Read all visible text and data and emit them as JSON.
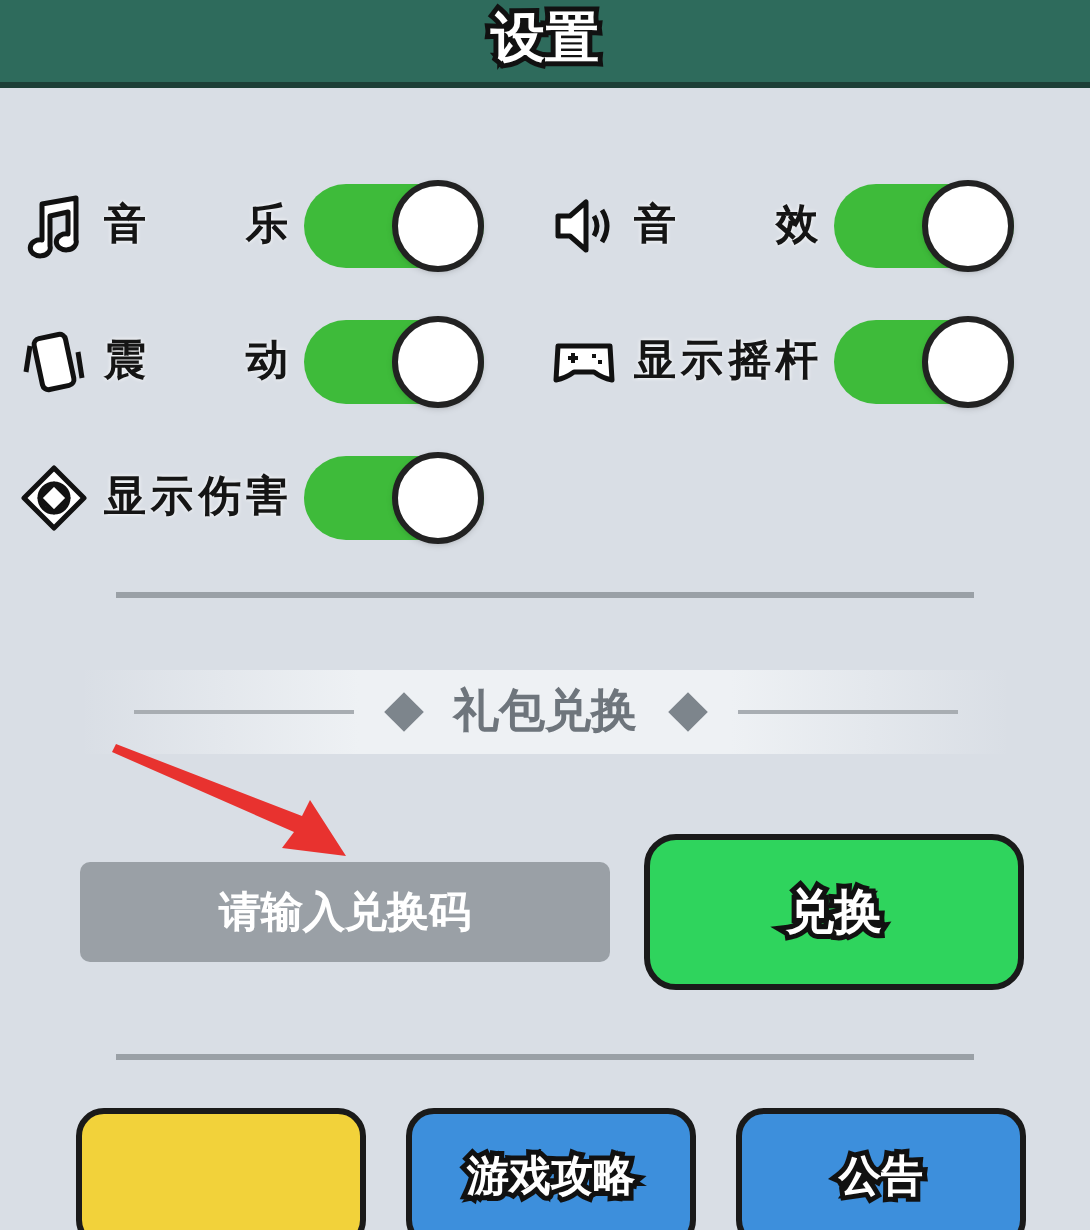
{
  "window": {
    "title": "设置"
  },
  "settings": [
    {
      "label": "音乐",
      "on": true
    },
    {
      "label": "音效",
      "on": true
    },
    {
      "label": "震动",
      "on": true
    },
    {
      "label": "显示摇杆",
      "on": true
    },
    {
      "label": "显示伤害",
      "on": true
    }
  ],
  "gift": {
    "title": "礼包兑换",
    "code_field": {
      "placeholder": "请输入兑换码"
    },
    "redeem_button": "兑换"
  },
  "bottom_buttons": [
    {
      "kind": "yellow"
    },
    {
      "kind": "blue",
      "label": "游戏攻略"
    },
    {
      "kind": "blue",
      "label": "公告"
    }
  ]
}
